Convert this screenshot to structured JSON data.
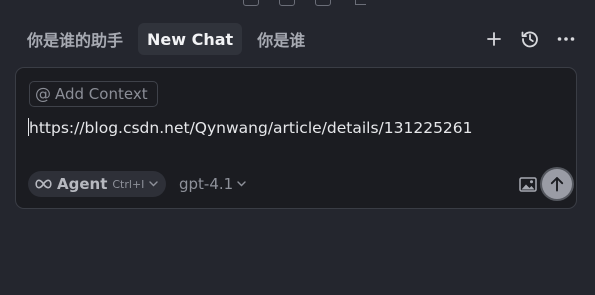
{
  "tabs": [
    {
      "label": "你是谁的助手",
      "active": false
    },
    {
      "label": "New Chat",
      "active": true
    },
    {
      "label": "你是谁",
      "active": false
    }
  ],
  "top_actions": {
    "new_icon": "plus-icon",
    "history_icon": "history-icon",
    "more_icon": "more-icon"
  },
  "composer": {
    "add_context_label": "Add Context",
    "input_value": "https://blog.csdn.net/Qynwang/article/details/131225261",
    "agent_label": "Agent",
    "agent_shortcut": "Ctrl+I",
    "model_label": "gpt-4.1"
  },
  "colors": {
    "background": "#24262e",
    "panel": "#1b1c21",
    "active_tab": "#30333b",
    "send_button": "#9a9ca5"
  }
}
